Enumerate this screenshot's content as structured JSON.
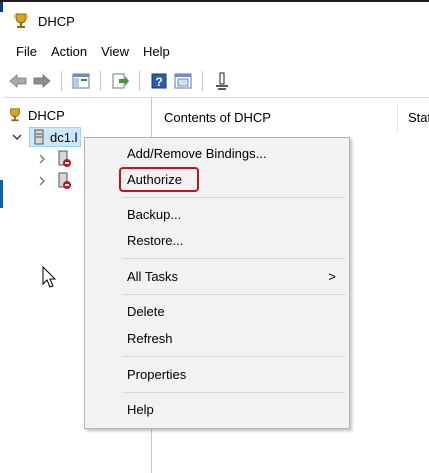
{
  "window": {
    "title": "DHCP"
  },
  "menubar": {
    "items": [
      "File",
      "Action",
      "View",
      "Help"
    ]
  },
  "toolbar": {
    "buttons": [
      "back-icon",
      "forward-icon",
      "console-tree-icon",
      "export-list-icon",
      "help-icon",
      "properties-pane-icon",
      "filter-icon"
    ]
  },
  "tree": {
    "root": "DHCP",
    "server": "dc1.l"
  },
  "content": {
    "columns": [
      "Contents of DHCP",
      "Stat"
    ]
  },
  "context_menu": {
    "items": {
      "add_remove_bindings": "Add/Remove Bindings...",
      "authorize": "Authorize",
      "backup": "Backup...",
      "restore": "Restore...",
      "all_tasks": "All Tasks",
      "delete": "Delete",
      "refresh": "Refresh",
      "properties": "Properties",
      "help": "Help"
    },
    "submenu_arrow": ">",
    "highlighted_item": "Authorize",
    "highlight_color": "#c4121e"
  }
}
